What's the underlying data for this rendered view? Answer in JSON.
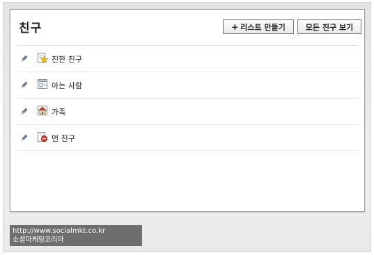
{
  "panel": {
    "title": "친구",
    "create_list_button": {
      "plus": "+",
      "label": "리스트 만들기"
    },
    "view_all_button": {
      "label": "모든 친구 보기"
    }
  },
  "friend_lists": [
    {
      "label": "친한 친구",
      "icon": "star-list-icon",
      "edit_icon": "pencil-icon"
    },
    {
      "label": "아는 사람",
      "icon": "acquaintance-list-icon",
      "edit_icon": "pencil-icon"
    },
    {
      "label": "가족",
      "icon": "house-list-icon",
      "edit_icon": "pencil-icon"
    },
    {
      "label": "먼 친구",
      "icon": "restricted-list-icon",
      "edit_icon": "pencil-icon"
    }
  ],
  "watermark": {
    "url": "http://www.socialmkt.co.kr",
    "name": "소셜마케팅코리아"
  },
  "colors": {
    "frame_background": "#e9e9e9",
    "panel_border": "#9a9a9a",
    "watermark_background": "#6e6e6e",
    "star": "#f2c200",
    "house_roof": "#c0392b",
    "restricted": "#d0302a"
  }
}
